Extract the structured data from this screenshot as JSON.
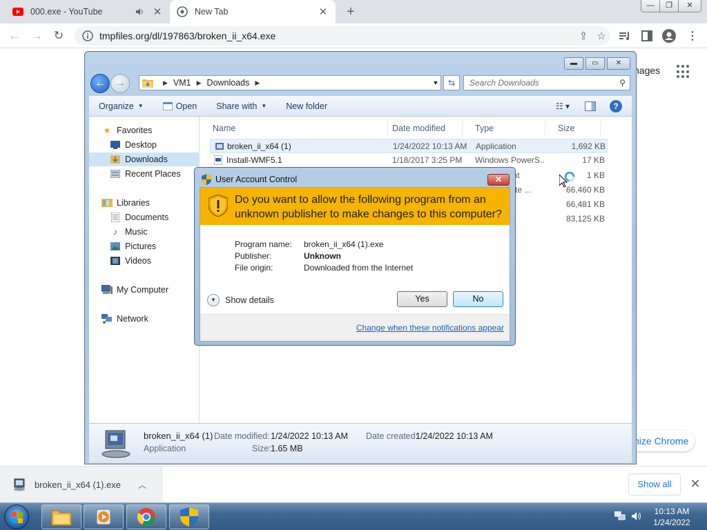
{
  "browser": {
    "tabs": [
      {
        "title": "000.exe - YouTube",
        "favicon": "youtube-icon",
        "audio": true
      },
      {
        "title": "New Tab",
        "favicon": "chrome-icon",
        "active": true
      }
    ],
    "url": "tmpfiles.org/dl/197863/broken_ii_x64.exe",
    "ntp_partial_text": "nages",
    "customize_label": "nize Chrome",
    "download": {
      "filename": "broken_ii_x64 (1).exe"
    },
    "show_all_label": "Show all"
  },
  "explorer": {
    "breadcrumb": [
      "VM1",
      "Downloads"
    ],
    "search_placeholder": "Search Downloads",
    "commands": {
      "organize": "Organize",
      "open": "Open",
      "share_with": "Share with",
      "new_folder": "New folder"
    },
    "nav": {
      "favorites": "Favorites",
      "desktop": "Desktop",
      "downloads": "Downloads",
      "recent_places": "Recent Places",
      "libraries": "Libraries",
      "documents": "Documents",
      "music": "Music",
      "pictures": "Pictures",
      "videos": "Videos",
      "my_computer": "My Computer",
      "network": "Network"
    },
    "columns": {
      "name": "Name",
      "date": "Date modified",
      "type": "Type",
      "size": "Size"
    },
    "files": [
      {
        "name": "broken_ii_x64 (1)",
        "date": "1/24/2022 10:13 AM",
        "type": "Application",
        "size": "1,692 KB"
      },
      {
        "name": "Install-WMF5.1",
        "date": "1/18/2017 3:25 PM",
        "type": "Windows PowerS...",
        "size": "17 KB"
      }
    ],
    "partial_rows": [
      {
        "type": "ment",
        "size": "1 KB"
      },
      {
        "type": "pdate ...",
        "size": "66,460 KB"
      },
      {
        "type": "",
        "size": "66,481 KB"
      },
      {
        "type": "",
        "size": "83,125 KB"
      }
    ],
    "details": {
      "name": "broken_ii_x64 (1)",
      "type": "Application",
      "date_modified_label": "Date modified:",
      "date_modified": "1/24/2022 10:13 AM",
      "date_created_label": "Date created:",
      "date_created": "1/24/2022 10:13 AM",
      "size_label": "Size:",
      "size": "1.65 MB"
    }
  },
  "uac": {
    "title": "User Account Control",
    "question": "Do you want to allow the following program from an unknown publisher to make changes to this computer?",
    "program_name_label": "Program name:",
    "program_name": "broken_ii_x64 (1).exe",
    "publisher_label": "Publisher:",
    "publisher": "Unknown",
    "file_origin_label": "File origin:",
    "file_origin": "Downloaded from the Internet",
    "show_details": "Show details",
    "yes": "Yes",
    "no": "No",
    "change_link": "Change when these notifications appear"
  },
  "taskbar": {
    "time": "10:13 AM",
    "date": "1/24/2022"
  }
}
